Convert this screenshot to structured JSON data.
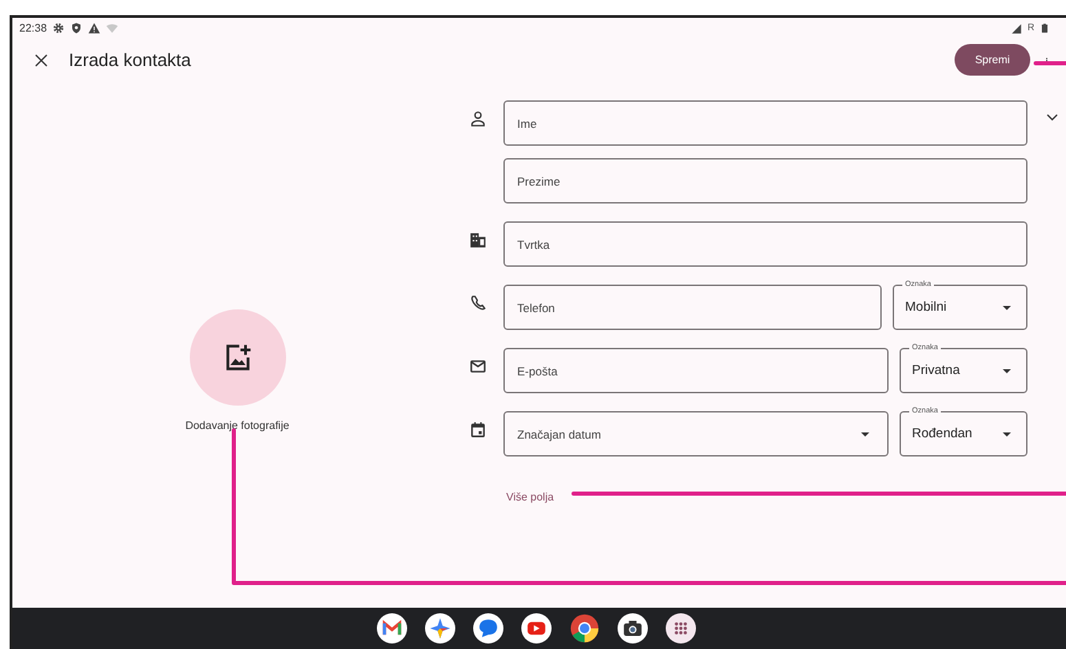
{
  "status_bar": {
    "time": "22:38",
    "network_letter": "R"
  },
  "app_bar": {
    "title": "Izrada kontakta",
    "save_button": "Spremi"
  },
  "photo": {
    "label": "Dodavanje fotografije"
  },
  "fields": [
    {
      "kind": "name",
      "placeholder": "Ime"
    },
    {
      "kind": "name_extra",
      "placeholder": "Prezime"
    },
    {
      "kind": "company",
      "placeholder": "Tvrtka"
    },
    {
      "kind": "phone",
      "placeholder": "Telefon",
      "type_label": "Oznaka",
      "type_value": "Mobilni"
    },
    {
      "kind": "email",
      "placeholder": "E-pošta",
      "type_label": "Oznaka",
      "type_value": "Privatna"
    },
    {
      "kind": "date",
      "placeholder": "Značajan datum",
      "type_label": "Oznaka",
      "type_value": "Rođendan"
    }
  ],
  "more_fields": "Više polja"
}
